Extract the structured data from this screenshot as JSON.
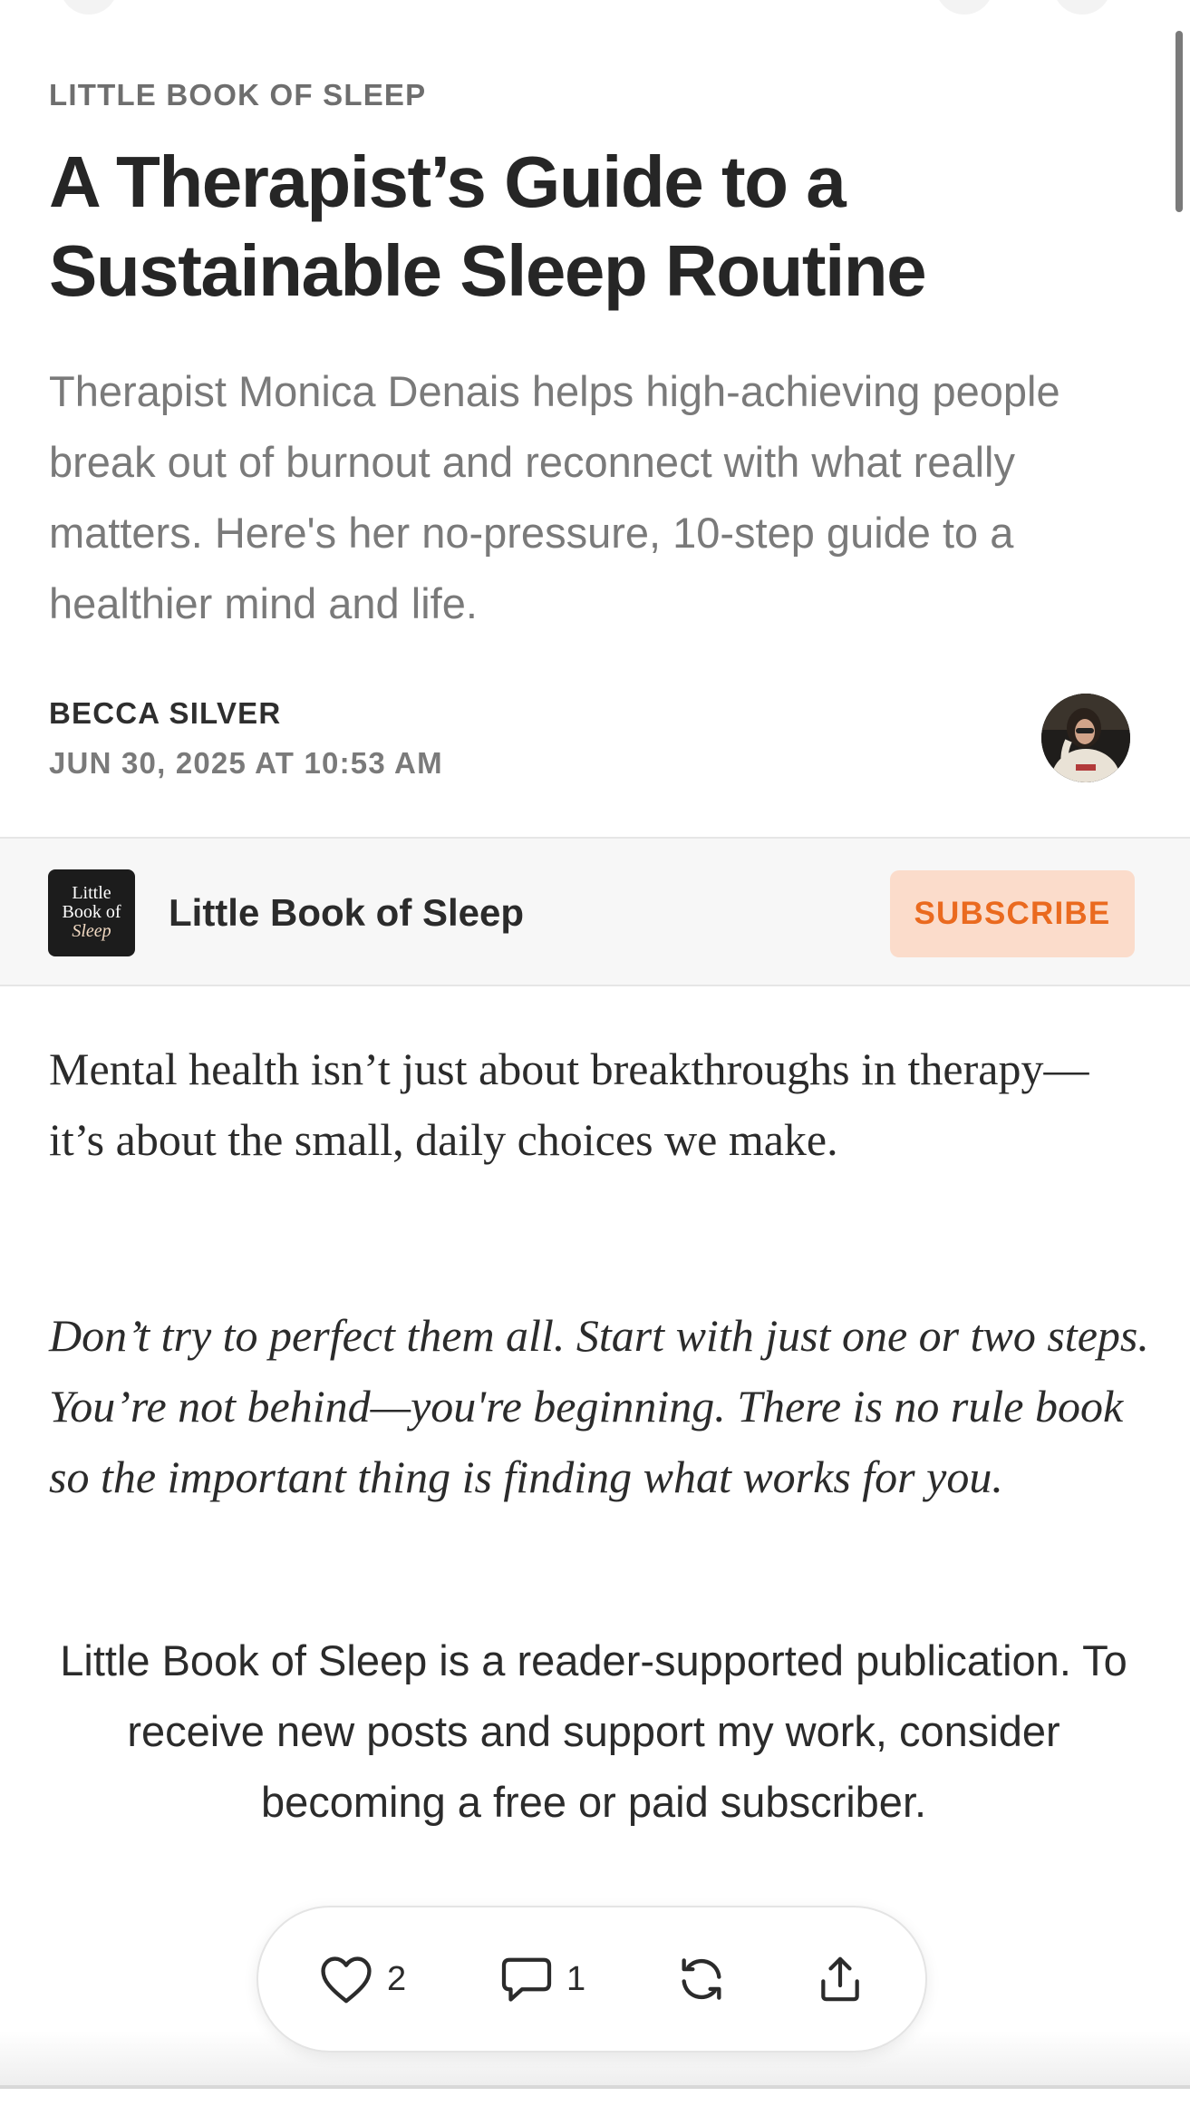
{
  "article": {
    "eyebrow": "LITTLE BOOK OF SLEEP",
    "title": "A Therapist’s Guide to a Sustainable Sleep Routine",
    "subtitle": "Therapist Monica Denais helps high-achieving people break out of burnout and reconnect with what really matters. Here's her no-pressure, 10-step guide to a healthier mind and life.",
    "author": "BECCA SILVER",
    "date": "JUN 30, 2025 AT 10:53 AM"
  },
  "publication": {
    "name": "Little Book of Sleep",
    "logo_line1": "Little",
    "logo_line2": "Book of",
    "logo_line3": "Sleep",
    "subscribe_label": "SUBSCRIBE",
    "accent_color": "#ea6a1f",
    "button_bg": "#fbdccb"
  },
  "body": {
    "paragraph1": "Mental health isn’t just about breakthroughs in therapy—it’s about the small, daily choices we make.",
    "paragraph2_italic": "Don’t try to perfect them all. Start with just one or two steps. You’re not behind—you're beginning. There is no rule book so the important thing is finding what works for you.",
    "support_notice": "Little Book of Sleep is a reader-supported publication. To receive new posts and support my work, consider becoming a free or paid subscriber."
  },
  "actions": {
    "like_icon": "heart-icon",
    "like_count": "2",
    "comment_icon": "comment-icon",
    "comment_count": "1",
    "restack_icon": "restack-icon",
    "share_icon": "share-icon"
  }
}
